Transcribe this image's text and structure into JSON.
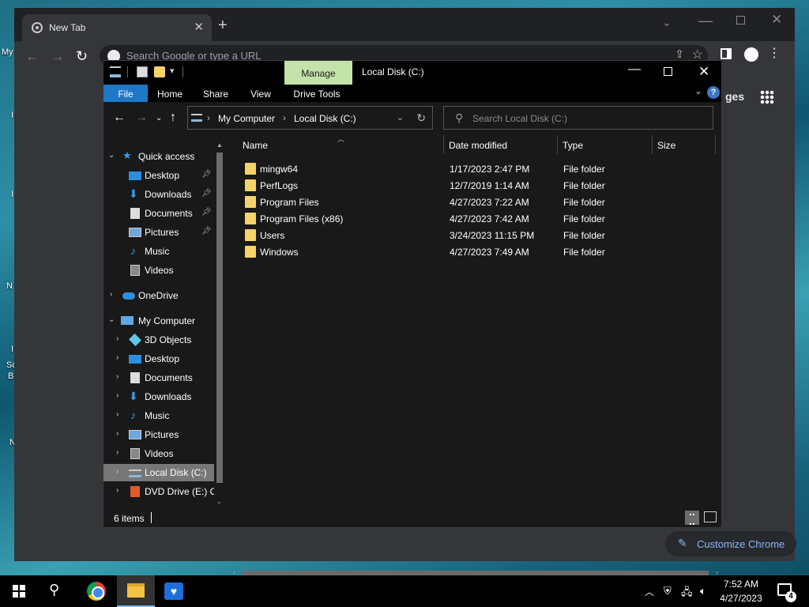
{
  "desktop": {
    "fragments": [
      "My",
      "I",
      "I",
      "N",
      "I",
      "Sc",
      "B",
      "N"
    ]
  },
  "chrome": {
    "tab_title": "New Tab",
    "omnibox_placeholder": "Search Google or type a URL",
    "images_label": "ges",
    "customize_label": "Customize Chrome"
  },
  "explorer": {
    "context_tab": "Manage",
    "window_title": "Local Disk (C:)",
    "ribbon_tabs": {
      "file": "File",
      "home": "Home",
      "share": "Share",
      "view": "View",
      "drive_tools": "Drive Tools"
    },
    "breadcrumb": [
      "My Computer",
      "Local Disk (C:)"
    ],
    "search_placeholder": "Search Local Disk (C:)",
    "nav_tree": {
      "quick_access": "Quick access",
      "qa_desktop": "Desktop",
      "qa_downloads": "Downloads",
      "qa_documents": "Documents",
      "qa_pictures": "Pictures",
      "qa_music": "Music",
      "qa_videos": "Videos",
      "onedrive": "OneDrive",
      "my_computer": "My Computer",
      "pc_3d": "3D Objects",
      "pc_desktop": "Desktop",
      "pc_documents": "Documents",
      "pc_downloads": "Downloads",
      "pc_music": "Music",
      "pc_pictures": "Pictures",
      "pc_videos": "Videos",
      "pc_local_disk": "Local Disk (C:)",
      "pc_dvd": "DVD Drive (E:) O"
    },
    "columns": {
      "name": "Name",
      "date_modified": "Date modified",
      "type": "Type",
      "size": "Size"
    },
    "files": [
      {
        "name": "mingw64",
        "date": "1/17/2023 2:47 PM",
        "type": "File folder"
      },
      {
        "name": "PerfLogs",
        "date": "12/7/2019 1:14 AM",
        "type": "File folder"
      },
      {
        "name": "Program Files",
        "date": "4/27/2023 7:22 AM",
        "type": "File folder"
      },
      {
        "name": "Program Files (x86)",
        "date": "4/27/2023 7:42 AM",
        "type": "File folder"
      },
      {
        "name": "Users",
        "date": "3/24/2023 11:15 PM",
        "type": "File folder"
      },
      {
        "name": "Windows",
        "date": "4/27/2023 7:49 AM",
        "type": "File folder"
      }
    ],
    "status_count": "6 items"
  },
  "taskbar": {
    "time": "7:52 AM",
    "date": "4/27/2023",
    "notification_count": "4"
  },
  "colors": {
    "manage_tab": "#c3e3aa",
    "file_tab": "#1e78c7",
    "folder": "#f6d36a",
    "chrome_accent": "#8ab4f8"
  }
}
